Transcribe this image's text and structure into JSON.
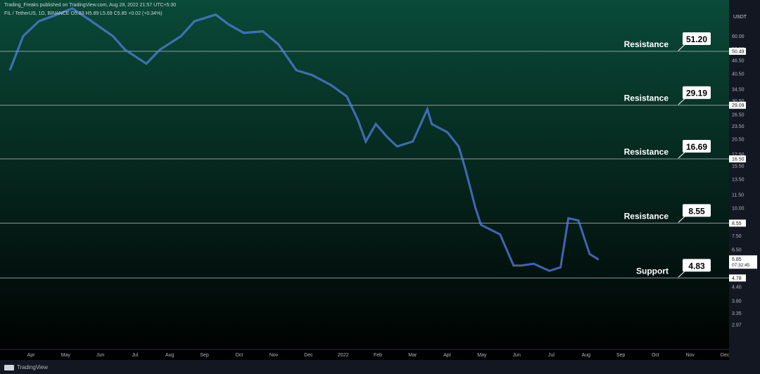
{
  "header": {
    "published": "Trading_Freaks published on TradingView.com, Aug 28, 2022 21:57 UTC+5:30",
    "symbol_info": "FIL / TetherUS, 1D, BINANCE  O5.83 H5.89 L5.69 C5.85 +0.02 (+0.34%)"
  },
  "footer": {
    "brand": "TradingView"
  },
  "chart_data": {
    "type": "line",
    "title": "",
    "xlabel": "",
    "ylabel": "USDT",
    "y_scale": "log",
    "ylim": [
      2.6,
      80
    ],
    "x_ticks": [
      "Apr",
      "May",
      "Jun",
      "Jul",
      "Aug",
      "Sep",
      "Oct",
      "Nov",
      "Dec",
      "2022",
      "Feb",
      "Mar",
      "Apr",
      "May",
      "Jun",
      "Jul",
      "Aug",
      "Sep",
      "Oct",
      "Nov",
      "Dec"
    ],
    "y_ticks": [
      "60.00",
      "52.50",
      "46.50",
      "40.50",
      "34.50",
      "30.50",
      "26.50",
      "23.50",
      "20.50",
      "17.50",
      "15.50",
      "13.50",
      "11.50",
      "10.00",
      "8.55",
      "7.50",
      "6.50",
      "5.85",
      "4.78",
      "4.40",
      "3.80",
      "3.35",
      "2.97"
    ],
    "price_series": {
      "x": [
        "2021-03-20",
        "2021-04-01",
        "2021-04-15",
        "2021-05-01",
        "2021-05-15",
        "2021-06-01",
        "2021-06-20",
        "2021-07-01",
        "2021-07-20",
        "2021-08-01",
        "2021-08-20",
        "2021-09-01",
        "2021-09-20",
        "2021-10-01",
        "2021-10-15",
        "2021-11-01",
        "2021-11-15",
        "2021-12-01",
        "2021-12-15",
        "2022-01-01",
        "2022-01-15",
        "2022-01-25",
        "2022-02-01",
        "2022-02-10",
        "2022-02-20",
        "2022-03-01",
        "2022-03-15",
        "2022-03-28",
        "2022-04-01",
        "2022-04-15",
        "2022-04-25",
        "2022-05-01",
        "2022-05-10",
        "2022-05-15",
        "2022-06-01",
        "2022-06-13",
        "2022-06-20",
        "2022-07-01",
        "2022-07-15",
        "2022-07-25",
        "2022-08-01",
        "2022-08-10",
        "2022-08-20",
        "2022-08-28"
      ],
      "y": [
        42,
        60,
        70,
        75,
        80,
        70,
        60,
        52,
        45,
        52,
        60,
        70,
        75,
        68,
        62,
        63,
        55,
        42,
        40,
        36,
        32,
        25,
        20,
        24,
        21,
        19,
        20,
        28,
        24,
        22,
        19,
        15,
        10,
        8.4,
        7.6,
        5.5,
        5.5,
        5.6,
        5.2,
        5.4,
        9,
        8.8,
        6.2,
        5.85
      ]
    },
    "levels": [
      {
        "label": "Resistance",
        "value": 51.2,
        "value_text": "51.20",
        "axis_tag": "50.49"
      },
      {
        "label": "Resistance",
        "value": 29.19,
        "value_text": "29.19",
        "axis_tag": "29.09"
      },
      {
        "label": "Resistance",
        "value": 16.69,
        "value_text": "16.69",
        "axis_tag": "16.50"
      },
      {
        "label": "Resistance",
        "value": 8.55,
        "value_text": "8.55",
        "axis_tag": "8.55"
      },
      {
        "label": "Support",
        "value": 4.83,
        "value_text": "4.83",
        "axis_tag": "4.78"
      }
    ],
    "current_price": {
      "value": 5.85,
      "value_text": "5.85",
      "countdown": "07:32:45"
    },
    "colors": {
      "line": "#2962ff",
      "line_highlight": "#ffffff",
      "level": "#b2b5be",
      "bg_top": "#0a4a38",
      "bg_bottom": "#000000"
    },
    "grid": false
  }
}
